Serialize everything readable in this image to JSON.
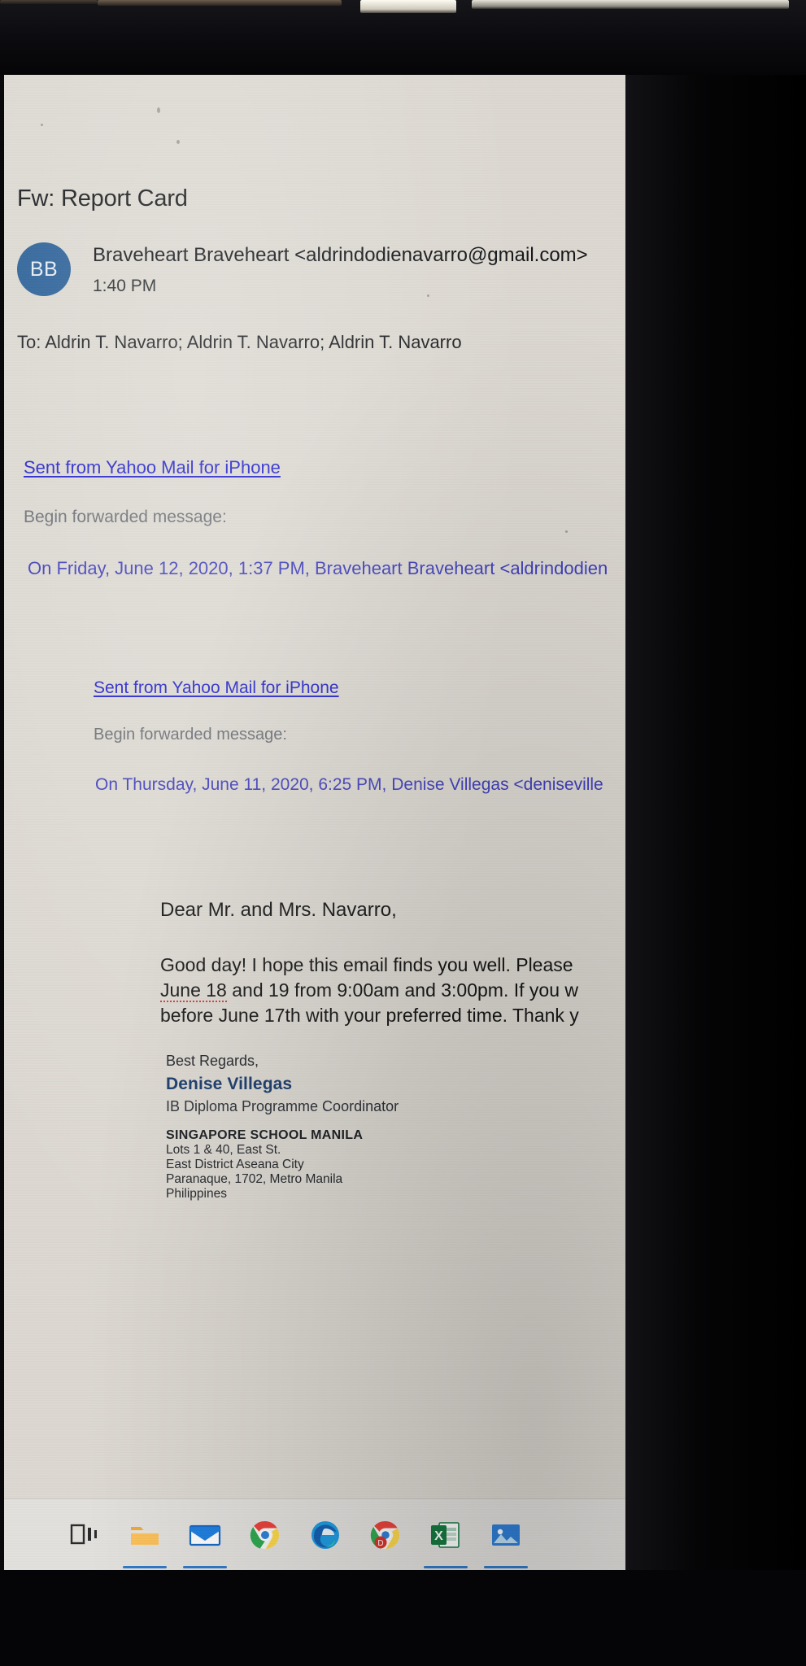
{
  "window": {
    "type": "email-reading-pane",
    "app": "Outlook Mail"
  },
  "email": {
    "subject": "Fw: Report Card",
    "avatar_initials": "BB",
    "sender": "Braveheart Braveheart <aldrindodienavarro@gmail.com>",
    "time": "1:40 PM",
    "recipients": "To: Aldrin T. Navarro; Aldrin T. Navarro; Aldrin T. Navarro"
  },
  "forward_level_1": {
    "sent_from": "Sent from Yahoo Mail for iPhone",
    "begin": "Begin forwarded message:",
    "on_line": "On Friday, June 12, 2020, 1:37 PM, Braveheart Braveheart <aldrindodien"
  },
  "forward_level_2": {
    "sent_from": "Sent from Yahoo Mail for iPhone",
    "begin": "Begin forwarded message:",
    "on_line": "On Thursday, June 11, 2020, 6:25 PM, Denise Villegas <deniseville"
  },
  "message": {
    "greeting": "Dear Mr. and Mrs. Navarro,",
    "body_line_1_a": "Good day! I hope this email finds you well. Please",
    "body_line_2_a": "June 18",
    "body_line_2_b": " and 19 from 9:00am and 3:00pm. If you w",
    "body_line_3": "before June 17th with your preferred time. Thank y"
  },
  "signature": {
    "regards": "Best Regards,",
    "name": "Denise Villegas",
    "title": "IB Diploma Programme Coordinator",
    "school": "SINGAPORE SCHOOL MANILA",
    "address_lines": [
      "Lots 1 & 40, East St.",
      "East District Aseana City",
      "Paranaque, 1702, Metro Manila",
      "Philippines"
    ]
  },
  "taskbar": {
    "items": [
      {
        "name": "task-view",
        "label": "Task View"
      },
      {
        "name": "file-explorer",
        "label": "File Explorer"
      },
      {
        "name": "mail",
        "label": "Mail"
      },
      {
        "name": "google-chrome",
        "label": "Google Chrome"
      },
      {
        "name": "microsoft-edge",
        "label": "Microsoft Edge"
      },
      {
        "name": "chrome-canary",
        "label": "Chrome"
      },
      {
        "name": "microsoft-excel",
        "label": "Excel"
      },
      {
        "name": "photos",
        "label": "Photos"
      }
    ]
  },
  "colors": {
    "avatar_blue": "#2a6098",
    "link_blue": "#2222cc",
    "quote_blue": "#3f3fbb",
    "sig_name_blue": "#173a6b",
    "screen_bg": "#ddd9d2",
    "taskbar_bg": "#e3e1de"
  }
}
